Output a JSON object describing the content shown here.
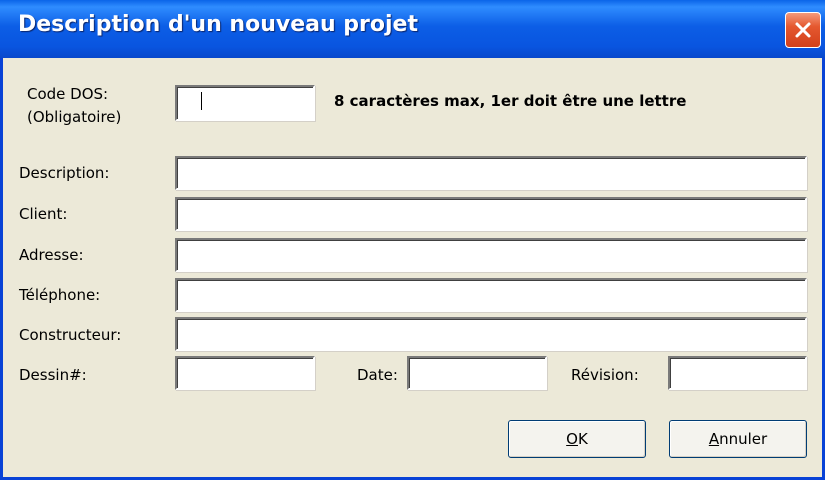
{
  "window": {
    "title": "Description d'un nouveau projet"
  },
  "form": {
    "code_dos_label_line1": "Code DOS:",
    "code_dos_label_line2": "(Obligatoire)",
    "code_dos_value": "",
    "code_dos_hint": "8 caractères max, 1er doit être une lettre",
    "description_label": "Description:",
    "description_value": "",
    "client_label": "Client:",
    "client_value": "",
    "adresse_label": "Adresse:",
    "adresse_value": "",
    "telephone_label": "Téléphone:",
    "telephone_value": "",
    "constructeur_label": "Constructeur:",
    "constructeur_value": "",
    "dessin_label": "Dessin#:",
    "dessin_value": "",
    "date_label": "Date:",
    "date_value": "",
    "revision_label": "Révision:",
    "revision_value": ""
  },
  "buttons": {
    "ok_mnemonic": "O",
    "ok_rest": "K",
    "annuler_mnemonic": "A",
    "annuler_rest": "nnuler"
  },
  "icons": {
    "close": "close-icon"
  },
  "colors": {
    "titlebar": "#0a5ee6",
    "close_button": "#e5582f",
    "dialog_background": "#ece9d8"
  }
}
